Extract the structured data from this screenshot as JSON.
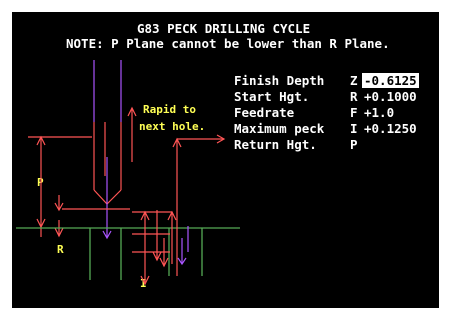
{
  "screen": {
    "title": "G83 PECK DRILLING CYCLE",
    "note": "NOTE: P Plane cannot be lower than R Plane."
  },
  "fields": [
    {
      "label": "Finish Depth",
      "letter": "Z",
      "value": "-0.6125",
      "active": true
    },
    {
      "label": "Start Hgt.",
      "letter": "R",
      "value": "+0.1000",
      "active": false
    },
    {
      "label": "Feedrate",
      "letter": "F",
      "value": "+1.0",
      "active": false
    },
    {
      "label": "Maximum peck",
      "letter": "I",
      "value": "+0.1250",
      "active": false
    },
    {
      "label": "Return Hgt.",
      "letter": "P",
      "value": "",
      "active": false
    }
  ],
  "diagram": {
    "rapid_note_line1": "Rapid to",
    "rapid_note_line2": "next hole.",
    "label_p": "P",
    "label_r": "R",
    "label_i": "I"
  },
  "colors": {
    "background": "#000000",
    "text": "#ffffff",
    "annotation": "#ffff55",
    "drill": "#ff5555",
    "plane": "#55aa55",
    "feed": "#aa55ff",
    "highlight": "#ffffff"
  }
}
